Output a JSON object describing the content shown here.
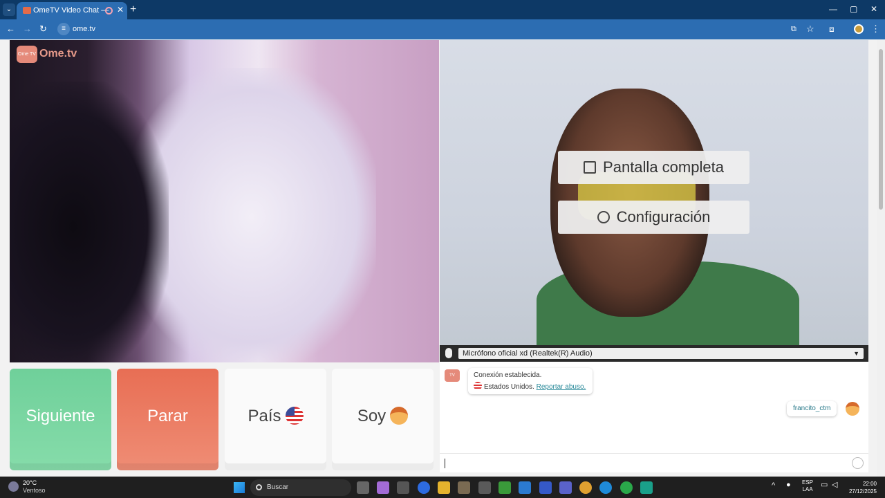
{
  "browser": {
    "tab_title": "OmeTV Video Chat — Omeg",
    "tab_close": "✕",
    "new_tab": "+",
    "url": "ome.tv",
    "window_controls": {
      "minimize": "—",
      "maximize": "▢",
      "close": "✕"
    }
  },
  "site": {
    "logo_text": "Ome.tv",
    "logo_badge": "Ome TV",
    "overlay": {
      "fullscreen_label": "Pantalla completa",
      "settings_label": "Configuración"
    },
    "mic_select": {
      "value": "Micrófono oficial xd (Realtek(R) Audio)"
    },
    "controls": {
      "next_label": "Siguiente",
      "stop_label": "Parar",
      "country_label": "País",
      "soy_label": "Soy"
    },
    "chat": {
      "system_line1": "Conexión establecida.",
      "system_country": "Estados Unidos.",
      "report_link": "Reportar abuso.",
      "username": "francito_ctm"
    }
  },
  "taskbar": {
    "weather_temp": "20°C",
    "weather_desc": "Ventoso",
    "search_placeholder": "Buscar",
    "language_top": "ESP",
    "language_bottom": "LAA",
    "time": "22:00",
    "date": "27/12/2025"
  },
  "colors": {
    "next_green": "#6fd09a",
    "stop_red": "#e86e54",
    "chrome_blue": "#2c6db2"
  },
  "icons": [
    "tab-search-icon",
    "back-icon",
    "forward-icon",
    "reload-icon",
    "site-info-icon",
    "install-icon",
    "star-icon",
    "extensions-icon",
    "profile-icon",
    "menu-icon",
    "fullscreen-icon",
    "gear-icon",
    "mic-icon",
    "flag-us-icon",
    "boy-face-icon",
    "emoji-icon"
  ]
}
